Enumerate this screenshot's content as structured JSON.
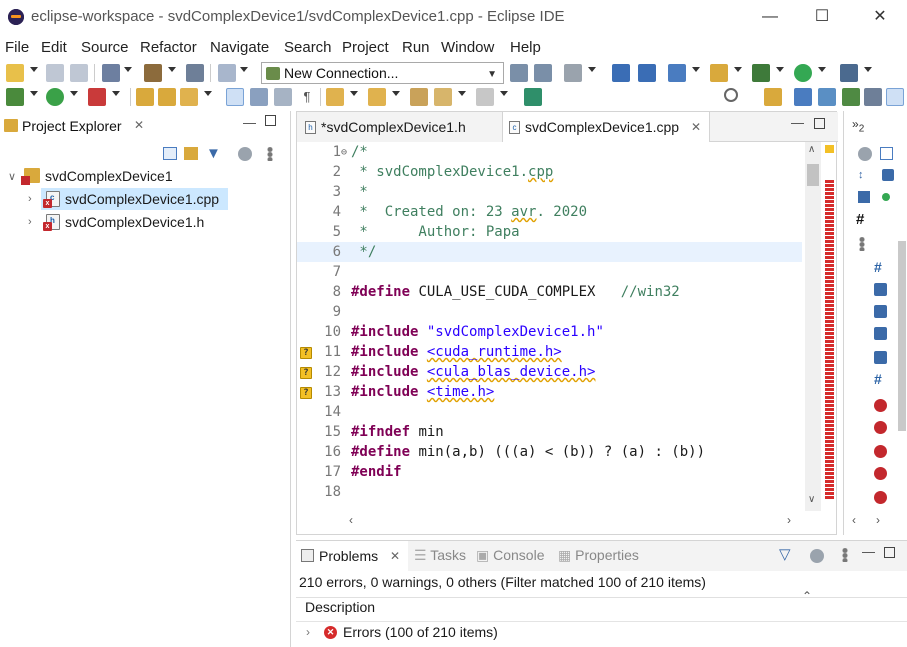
{
  "window": {
    "title": "eclipse-workspace - svdComplexDevice1/svdComplexDevice1.cpp - Eclipse IDE"
  },
  "menu": [
    "File",
    "Edit",
    "Source",
    "Refactor",
    "Navigate",
    "Search",
    "Project",
    "Run",
    "Window",
    "Help"
  ],
  "toolbar": {
    "connection": "New Connection..."
  },
  "project_explorer": {
    "title": "Project Explorer",
    "tree": [
      {
        "label": "svdComplexDevice1"
      },
      {
        "label": "svdComplexDevice1.cpp"
      },
      {
        "label": "svdComplexDevice1.h"
      }
    ]
  },
  "editor": {
    "tabs": [
      {
        "label": "*svdComplexDevice1.h"
      },
      {
        "label": "svdComplexDevice1.cpp"
      }
    ],
    "lines": [
      {
        "n": "1",
        "t": "/*"
      },
      {
        "n": "2",
        "t": " * svdComplexDevice1.cpp"
      },
      {
        "n": "3",
        "t": " *"
      },
      {
        "n": "4",
        "t": " *  Created on: 23 avr. 2020"
      },
      {
        "n": "5",
        "t": " *      Author: Papa"
      },
      {
        "n": "6",
        "t": " */"
      },
      {
        "n": "7",
        "t": ""
      },
      {
        "n": "8",
        "t": "#define CULA_USE_CUDA_COMPLEX   //win32"
      },
      {
        "n": "9",
        "t": ""
      },
      {
        "n": "10",
        "t": "#include \"svdComplexDevice1.h\""
      },
      {
        "n": "11",
        "t": "#include <cuda_runtime.h>"
      },
      {
        "n": "12",
        "t": "#include <cula_blas_device.h>"
      },
      {
        "n": "13",
        "t": "#include <time.h>"
      },
      {
        "n": "14",
        "t": ""
      },
      {
        "n": "15",
        "t": "#ifndef min"
      },
      {
        "n": "16",
        "t": "#define min(a,b) (((a) < (b)) ? (a) : (b))"
      },
      {
        "n": "17",
        "t": "#endif"
      },
      {
        "n": "18",
        "t": ""
      }
    ]
  },
  "problems": {
    "tabs": [
      "Problems",
      "Tasks",
      "Console",
      "Properties"
    ],
    "summary": "210 errors, 0 warnings, 0 others (Filter matched 100 of 210 items)",
    "column": "Description",
    "row": "Errors (100 of 210 items)"
  },
  "colors": {
    "keyword": "#7f0055",
    "comment": "#3f7f5f",
    "string": "#2a00ff",
    "error": "#d62b2b"
  }
}
